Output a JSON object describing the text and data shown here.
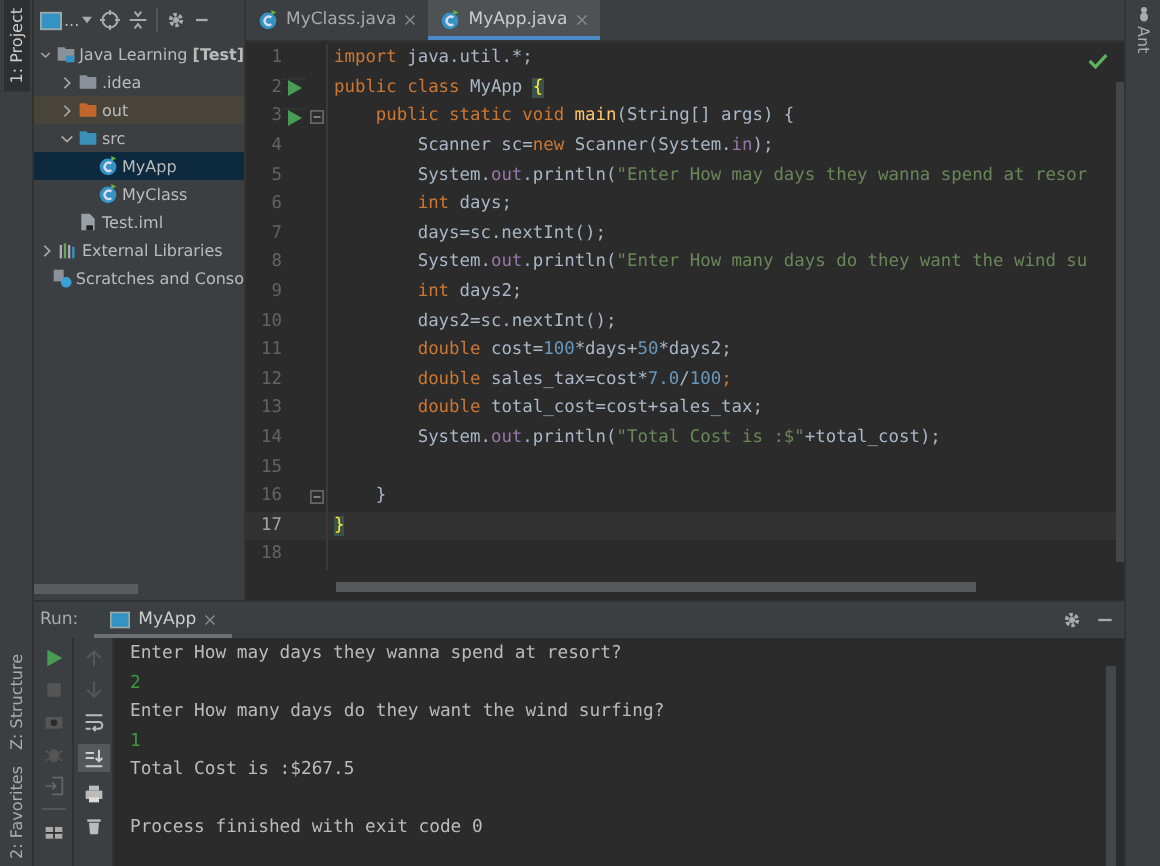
{
  "left_tool_tabs": [
    {
      "label": "1: Project",
      "selected": true
    },
    {
      "label": "Z: Structure",
      "selected": false
    },
    {
      "label": "2: Favorites",
      "selected": false
    }
  ],
  "right_tool_tabs": [
    {
      "label": "Ant",
      "selected": false
    }
  ],
  "project_toolbar": {
    "view_selector": "..."
  },
  "project_tree": [
    {
      "label": "Java Learning **[Test]**",
      "kind": "module",
      "expanded": true,
      "selected": false,
      "children": [
        {
          "label": ".idea",
          "kind": "folder",
          "expanded": false,
          "selected": false
        },
        {
          "label": "out",
          "kind": "excluded-folder",
          "expanded": false,
          "selected": false
        },
        {
          "label": "src",
          "kind": "source-folder",
          "expanded": true,
          "selected": false,
          "children": [
            {
              "label": "MyApp",
              "kind": "class",
              "selected": true
            },
            {
              "label": "MyClass",
              "kind": "class",
              "selected": false
            }
          ]
        },
        {
          "label": "Test.iml",
          "kind": "file",
          "selected": false
        }
      ]
    },
    {
      "label": "External Libraries",
      "kind": "library",
      "expanded": false,
      "selected": false
    },
    {
      "label": "Scratches and Conso",
      "kind": "scratches",
      "selected": false
    }
  ],
  "editor_tabs": [
    {
      "label": "MyClass.java",
      "selected": false
    },
    {
      "label": "MyApp.java",
      "selected": true
    }
  ],
  "code_lines": [
    {
      "number": "1",
      "run_marker": false,
      "fold": false,
      "current": false,
      "tokens": [
        {
          "kind": "keyword",
          "text": "import"
        },
        {
          "kind": "plain",
          "text": " java.util.*;"
        }
      ]
    },
    {
      "number": "2",
      "run_marker": true,
      "fold": false,
      "current": false,
      "tokens": [
        {
          "kind": "keyword",
          "text": "public class"
        },
        {
          "kind": "plain",
          "text": " MyApp "
        },
        {
          "kind": "brace",
          "text": "{"
        }
      ]
    },
    {
      "number": "3",
      "run_marker": true,
      "fold": true,
      "current": false,
      "tokens": [
        {
          "kind": "keyword",
          "text": "    public static void"
        },
        {
          "kind": "method",
          "text": " main"
        },
        {
          "kind": "plain",
          "text": "(String[] args) {"
        }
      ]
    },
    {
      "number": "4",
      "run_marker": false,
      "fold": false,
      "current": false,
      "tokens": [
        {
          "kind": "plain",
          "text": "        Scanner sc="
        },
        {
          "kind": "keyword",
          "text": "new"
        },
        {
          "kind": "plain",
          "text": " Scanner(System."
        },
        {
          "kind": "field",
          "text": "in"
        },
        {
          "kind": "plain",
          "text": ");"
        }
      ]
    },
    {
      "number": "5",
      "run_marker": false,
      "fold": false,
      "current": false,
      "tokens": [
        {
          "kind": "plain",
          "text": "        System."
        },
        {
          "kind": "field",
          "text": "out"
        },
        {
          "kind": "plain",
          "text": ".println("
        },
        {
          "kind": "string",
          "text": "\"Enter How may days they wanna spend at resor"
        }
      ]
    },
    {
      "number": "6",
      "run_marker": false,
      "fold": false,
      "current": false,
      "tokens": [
        {
          "kind": "keyword",
          "text": "        int"
        },
        {
          "kind": "plain",
          "text": " days;"
        }
      ]
    },
    {
      "number": "7",
      "run_marker": false,
      "fold": false,
      "current": false,
      "tokens": [
        {
          "kind": "plain",
          "text": "        days=sc.nextInt();"
        }
      ]
    },
    {
      "number": "8",
      "run_marker": false,
      "fold": false,
      "current": false,
      "tokens": [
        {
          "kind": "plain",
          "text": "        System."
        },
        {
          "kind": "field",
          "text": "out"
        },
        {
          "kind": "plain",
          "text": ".println("
        },
        {
          "kind": "string",
          "text": "\"Enter How many days do they want the wind su"
        }
      ]
    },
    {
      "number": "9",
      "run_marker": false,
      "fold": false,
      "current": false,
      "tokens": [
        {
          "kind": "keyword",
          "text": "        int"
        },
        {
          "kind": "plain",
          "text": " days2;"
        }
      ]
    },
    {
      "number": "10",
      "run_marker": false,
      "fold": false,
      "current": false,
      "tokens": [
        {
          "kind": "plain",
          "text": "        days2=sc.nextInt();"
        }
      ]
    },
    {
      "number": "11",
      "run_marker": false,
      "fold": false,
      "current": false,
      "tokens": [
        {
          "kind": "keyword",
          "text": "        double"
        },
        {
          "kind": "plain",
          "text": " cost="
        },
        {
          "kind": "number",
          "text": "100"
        },
        {
          "kind": "plain",
          "text": "*days+"
        },
        {
          "kind": "number",
          "text": "50"
        },
        {
          "kind": "plain",
          "text": "*days2;"
        }
      ]
    },
    {
      "number": "12",
      "run_marker": false,
      "fold": false,
      "current": false,
      "tokens": [
        {
          "kind": "keyword",
          "text": "        double"
        },
        {
          "kind": "plain",
          "text": " sales_tax=cost*"
        },
        {
          "kind": "number",
          "text": "7.0"
        },
        {
          "kind": "plain",
          "text": "/"
        },
        {
          "kind": "number",
          "text": "100"
        },
        {
          "kind": "keyword",
          "text": ";"
        }
      ]
    },
    {
      "number": "13",
      "run_marker": false,
      "fold": false,
      "current": false,
      "tokens": [
        {
          "kind": "keyword",
          "text": "        double"
        },
        {
          "kind": "plain",
          "text": " total_cost=cost+sales_tax;"
        }
      ]
    },
    {
      "number": "14",
      "run_marker": false,
      "fold": false,
      "current": false,
      "tokens": [
        {
          "kind": "plain",
          "text": "        System."
        },
        {
          "kind": "field",
          "text": "out"
        },
        {
          "kind": "plain",
          "text": ".println("
        },
        {
          "kind": "string",
          "text": "\"Total Cost is :$\""
        },
        {
          "kind": "plain",
          "text": "+total_cost);"
        }
      ]
    },
    {
      "number": "15",
      "run_marker": false,
      "fold": false,
      "current": false
    },
    {
      "number": "16",
      "run_marker": false,
      "fold": true,
      "current": false,
      "tokens": [
        {
          "kind": "plain",
          "text": "    }"
        }
      ]
    },
    {
      "number": "17",
      "run_marker": false,
      "fold": false,
      "current": true,
      "tokens": [
        {
          "kind": "brace",
          "text": "}"
        }
      ]
    },
    {
      "number": "18",
      "run_marker": false,
      "fold": false,
      "current": false
    }
  ],
  "run_panel": {
    "label": "Run:",
    "tabs": [
      {
        "label": "MyApp",
        "selected": true
      }
    ],
    "console": [
      {
        "kind": "output",
        "text": "Enter How may days they wanna spend at resort?"
      },
      {
        "kind": "input",
        "text": "2"
      },
      {
        "kind": "output",
        "text": "Enter How many days do they want the wind surfing?"
      },
      {
        "kind": "input",
        "text": "1"
      },
      {
        "kind": "output",
        "text": "Total Cost is :$267.5"
      },
      {
        "kind": "blank"
      },
      {
        "kind": "output",
        "text": "Process finished with exit code 0"
      }
    ]
  }
}
